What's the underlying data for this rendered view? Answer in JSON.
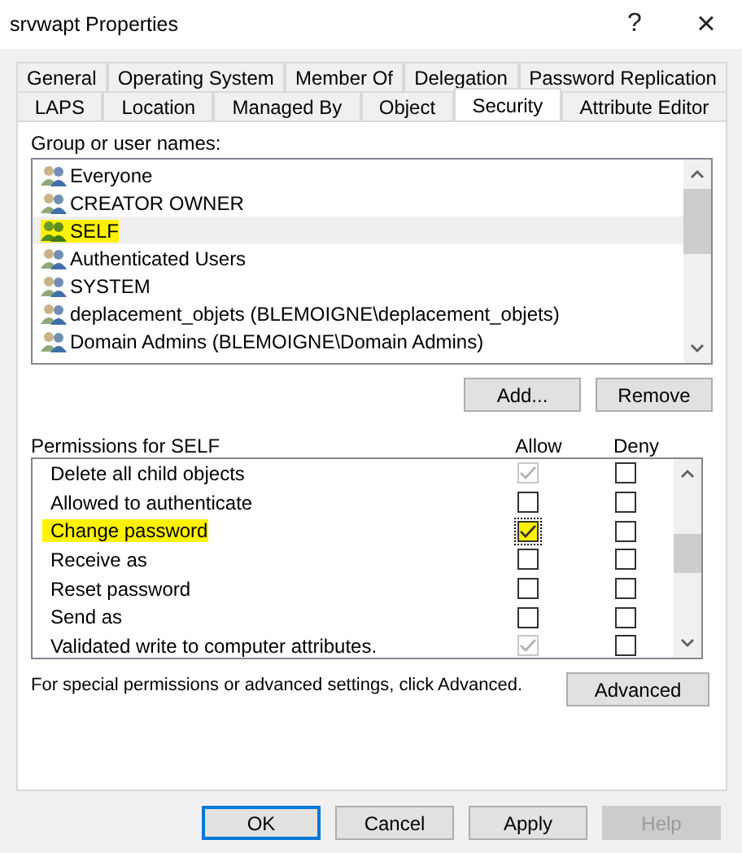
{
  "window": {
    "title": "srvwapt Properties",
    "help": "?",
    "close": "×"
  },
  "tab_rows": [
    [
      {
        "label": "General",
        "selected": false
      },
      {
        "label": "Operating System",
        "selected": false
      },
      {
        "label": "Member Of",
        "selected": false
      },
      {
        "label": "Delegation",
        "selected": false
      },
      {
        "label": "Password Replication",
        "selected": false
      }
    ],
    [
      {
        "label": "LAPS",
        "selected": false
      },
      {
        "label": "Location",
        "selected": false
      },
      {
        "label": "Managed By",
        "selected": false
      },
      {
        "label": "Object",
        "selected": false
      },
      {
        "label": "Security",
        "selected": true
      },
      {
        "label": "Attribute Editor",
        "selected": false
      }
    ]
  ],
  "groups": {
    "label": "Group or user names:",
    "items": [
      {
        "name": "Everyone",
        "selected": false,
        "highlighted": false
      },
      {
        "name": "CREATOR OWNER",
        "selected": false,
        "highlighted": false
      },
      {
        "name": "SELF",
        "selected": true,
        "highlighted": true
      },
      {
        "name": "Authenticated Users",
        "selected": false,
        "highlighted": false
      },
      {
        "name": "SYSTEM",
        "selected": false,
        "highlighted": false
      },
      {
        "name": "deplacement_objets (BLEMOIGNE\\deplacement_objets)",
        "selected": false,
        "highlighted": false
      },
      {
        "name": "Domain Admins (BLEMOIGNE\\Domain Admins)",
        "selected": false,
        "highlighted": false
      }
    ],
    "buttons": [
      "Add...",
      "Remove"
    ]
  },
  "permissions": {
    "label": "Permissions for SELF",
    "allow_header": "Allow",
    "deny_header": "Deny",
    "rows": [
      {
        "name": "Delete all child objects",
        "highlighted": false,
        "allow": {
          "checked": true,
          "disabled": true
        },
        "deny": {
          "checked": false,
          "disabled": false
        }
      },
      {
        "name": "Allowed to authenticate",
        "highlighted": false,
        "allow": {
          "checked": false,
          "disabled": false
        },
        "deny": {
          "checked": false,
          "disabled": false
        }
      },
      {
        "name": "Change password",
        "highlighted": true,
        "allow": {
          "checked": true,
          "disabled": false
        },
        "deny": {
          "checked": false,
          "disabled": false
        }
      },
      {
        "name": "Receive as",
        "highlighted": false,
        "allow": {
          "checked": false,
          "disabled": false
        },
        "deny": {
          "checked": false,
          "disabled": false
        }
      },
      {
        "name": "Reset password",
        "highlighted": false,
        "allow": {
          "checked": false,
          "disabled": false
        },
        "deny": {
          "checked": false,
          "disabled": false
        }
      },
      {
        "name": "Send as",
        "highlighted": false,
        "allow": {
          "checked": false,
          "disabled": false
        },
        "deny": {
          "checked": false,
          "disabled": false
        }
      },
      {
        "name": "Validated write to computer attributes.",
        "highlighted": false,
        "allow": {
          "checked": true,
          "disabled": true
        },
        "deny": {
          "checked": false,
          "disabled": false
        }
      }
    ]
  },
  "advanced": {
    "text": "For special permissions or advanced settings, click Advanced.",
    "button": "Advanced"
  },
  "footer_buttons": [
    {
      "label": "OK",
      "default": true,
      "disabled": false
    },
    {
      "label": "Cancel",
      "default": false,
      "disabled": false
    },
    {
      "label": "Apply",
      "default": false,
      "disabled": false
    },
    {
      "label": "Help",
      "default": false,
      "disabled": true
    }
  ]
}
